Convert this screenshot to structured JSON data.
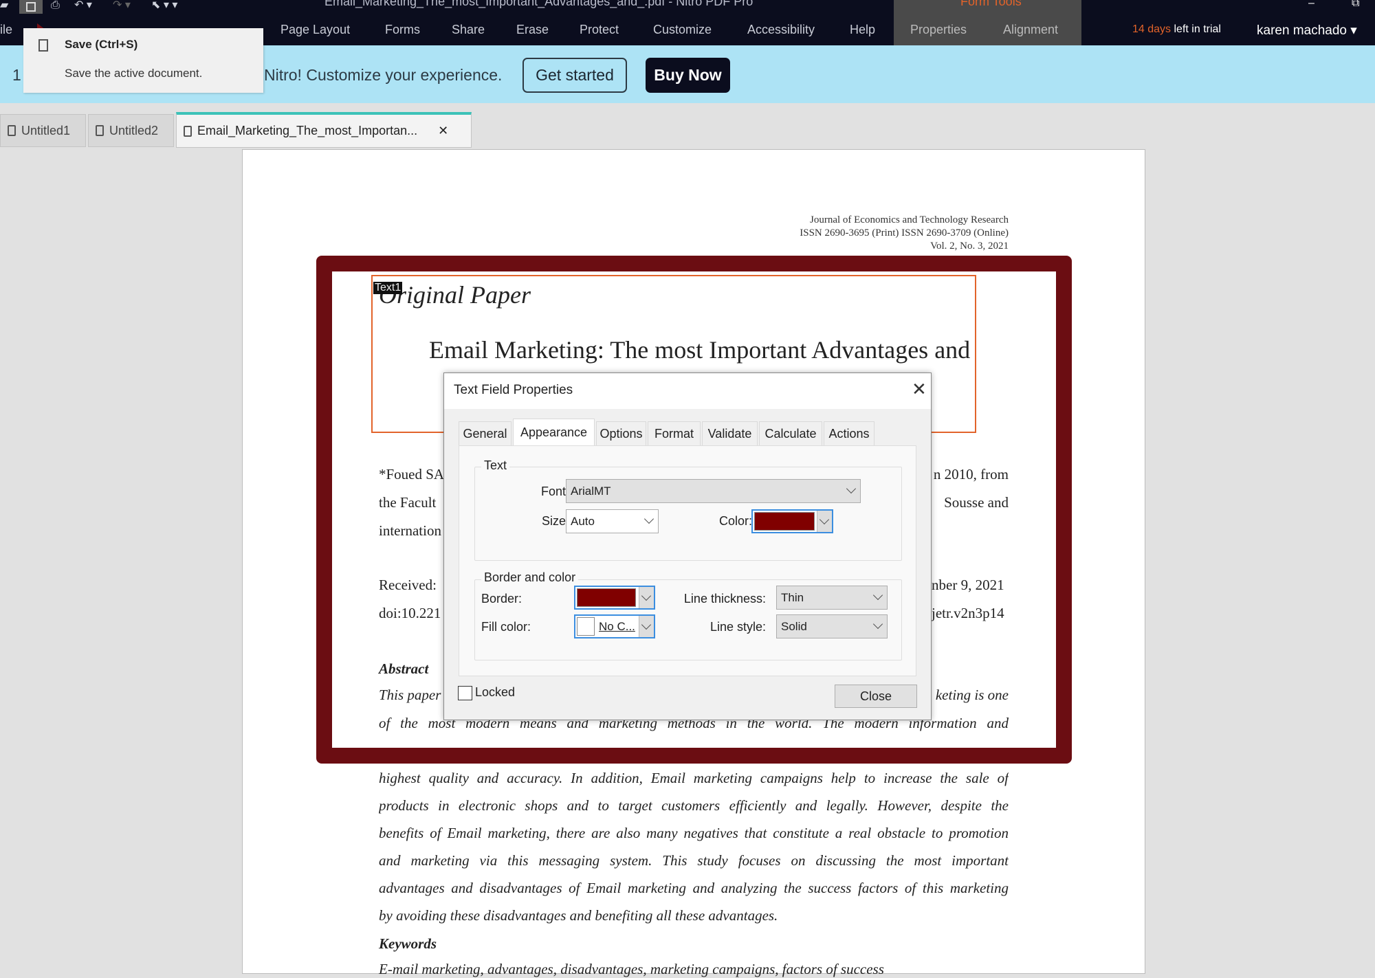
{
  "window": {
    "title": "Email_Marketing_The_most_Important_Advantages_and_.pdf - Nitro PDF Pro",
    "context_tab": "Form Tools",
    "quick_access_icons": [
      "folder-icon",
      "save-icon",
      "print-icon",
      "undo-icon",
      "redo-icon",
      "select-cursor-icon"
    ]
  },
  "menu": {
    "items": [
      "ile",
      "Page Layout",
      "Forms",
      "Share",
      "Erase",
      "Protect",
      "Customize",
      "Accessibility",
      "Help"
    ],
    "context_items": [
      "Properties",
      "Alignment"
    ],
    "trial_days": "14 days",
    "trial_rest": "left in trial",
    "user": "karen machado ▾"
  },
  "banner": {
    "prefix": "1",
    "text": "Nitro! Customize your experience.",
    "get_started": "Get started",
    "buy_now": "Buy Now"
  },
  "tooltip": {
    "title": "Save (Ctrl+S)",
    "description": "Save the active document."
  },
  "tabs": [
    {
      "label": "Untitled1"
    },
    {
      "label": "Untitled2"
    },
    {
      "label": "Email_Marketing_The_most_Importan...",
      "close": "✕"
    }
  ],
  "document": {
    "header": [
      "Journal of Economics and Technology Research",
      "ISSN 2690-3695 (Print) ISSN 2690-3709 (Online)",
      "Vol. 2, No. 3, 2021"
    ],
    "paper_type": "Original Paper",
    "title": "Email Marketing: The most Important Advantages and",
    "field_name": "Text1",
    "left_fragments": [
      "*Foued SA",
      "the Facult",
      "internation",
      "Received: ",
      "doi:10.221"
    ],
    "right_fragments": [
      "n 2010, from",
      "Sousse and",
      "",
      "nber 9, 2021",
      "jetr.v2n3p14"
    ],
    "abstract_heading": "Abstract",
    "abstract_fragment_left": "This paper",
    "abstract_fragment_right": "keting is one",
    "abstract_lines": [
      "of the most modern means and marketing methods in the world. The modern information and",
      "highest quality and accuracy. In addition, Email marketing campaigns help to increase the sale of",
      "products in electronic shops and to target customers efficiently and legally. However, despite the",
      "benefits of Email marketing, there are also many negatives that constitute a real obstacle to promotion",
      "and marketing via this messaging system. This study focuses on discussing the most important",
      "advantages and disadvantages of Email marketing and analyzing the success factors of this marketing",
      "by avoiding these disadvantages and benefiting all these advantages."
    ],
    "keywords_heading": "Keywords",
    "keywords": "E-mail marketing, advantages, disadvantages, marketing campaigns, factors of success"
  },
  "dialog": {
    "title": "Text Field Properties",
    "tabs": [
      "General",
      "Appearance",
      "Options",
      "Format",
      "Validate",
      "Calculate",
      "Actions"
    ],
    "active_tab": "Appearance",
    "text_group": "Text",
    "font_label": "Font:",
    "font_value": "ArialMT",
    "size_label": "Size:",
    "size_value": "Auto",
    "color_label": "Color:",
    "text_color": "#800000",
    "border_group": "Border and color",
    "border_label": "Border:",
    "border_color": "#800000",
    "fill_label": "Fill color:",
    "fill_value": "No C...",
    "thickness_label": "Line thickness:",
    "thickness_value": "Thin",
    "style_label": "Line style:",
    "style_value": "Solid",
    "locked_label": "Locked",
    "locked": false,
    "close_button": "Close"
  },
  "colors": {
    "frame": "#6b0d12",
    "accent": "#e2632a",
    "tab_accent": "#3cc2b8",
    "banner": "#ade3f5"
  }
}
